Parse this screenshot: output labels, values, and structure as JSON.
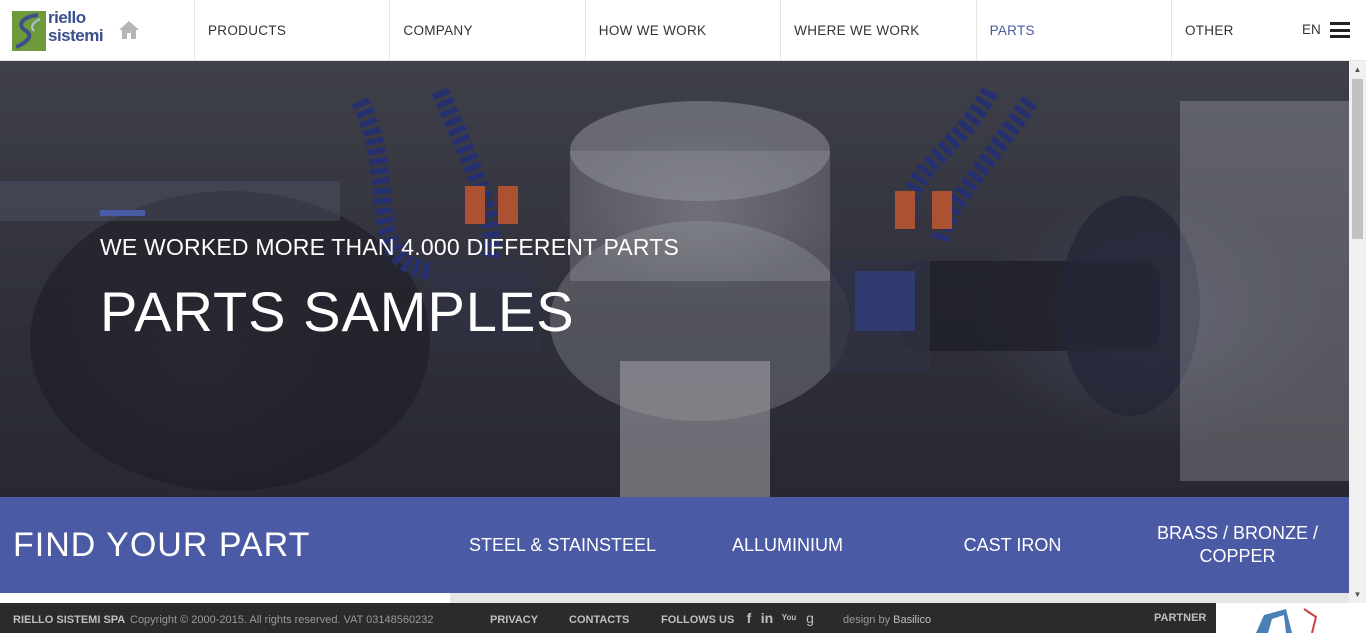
{
  "header": {
    "logo_line1": "riello",
    "logo_line2": "sistemi",
    "nav": [
      {
        "label": "PRODUCTS",
        "active": false
      },
      {
        "label": "COMPANY",
        "active": false
      },
      {
        "label": "HOW WE WORK",
        "active": false
      },
      {
        "label": "WHERE WE WORK",
        "active": false
      },
      {
        "label": "PARTS",
        "active": true
      },
      {
        "label": "OTHER",
        "active": false
      }
    ],
    "language": "EN",
    "icons": {
      "home": "home-icon",
      "menu": "hamburger-menu-icon"
    }
  },
  "hero": {
    "subtitle": "WE WORKED MORE THAN 4.000 DIFFERENT PARTS",
    "title": "PARTS SAMPLES"
  },
  "find_part": {
    "title": "FIND YOUR PART",
    "categories": [
      "STEEL & STAINSTEEL",
      "ALLUMINIUM",
      "CAST IRON",
      "BRASS / BRONZE / COPPER"
    ]
  },
  "footer": {
    "company": "RIELLO SISTEMI SPA",
    "copyright": "Copyright © 2000-2015. All rights reserved. VAT 03148560232",
    "privacy": "PRIVACY",
    "contacts": "CONTACTS",
    "follow": "FOLLOWS US",
    "social": [
      "f",
      "in",
      "You",
      "g"
    ],
    "design_prefix": "design by",
    "design_by": "Basilico",
    "partner": "PARTNER"
  },
  "colors": {
    "accent": "#4a5aa4",
    "logo_green": "#6f9a3c",
    "footer_bg": "#2b2b2b"
  }
}
